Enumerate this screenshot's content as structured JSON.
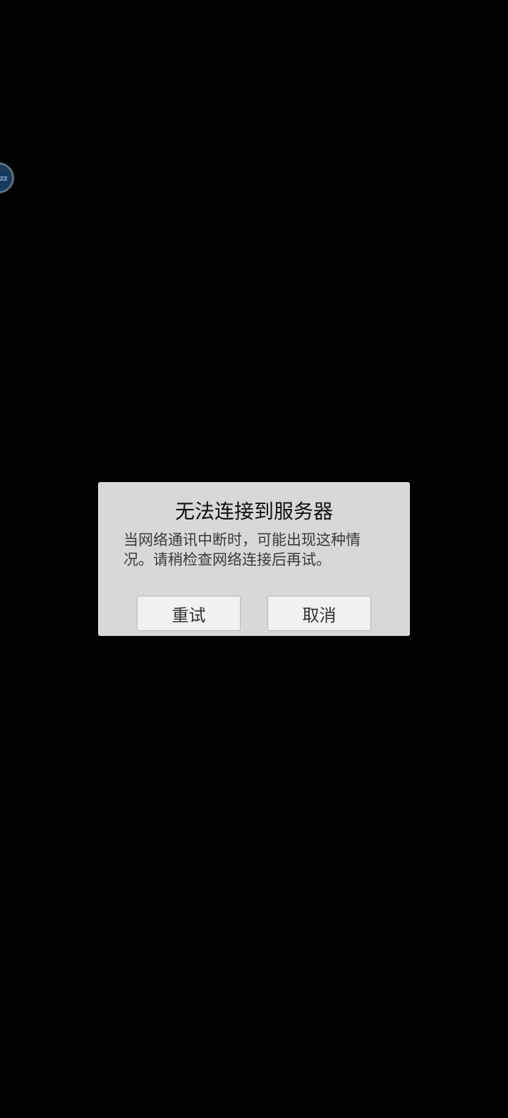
{
  "floating_bubble": {
    "label": "zz"
  },
  "dialog": {
    "title": "无法连接到服务器",
    "message": "当网络通讯中断时，可能出现这种情况。请稍检查网络连接后再试。",
    "buttons": {
      "retry_label": "重试",
      "cancel_label": "取消"
    }
  }
}
